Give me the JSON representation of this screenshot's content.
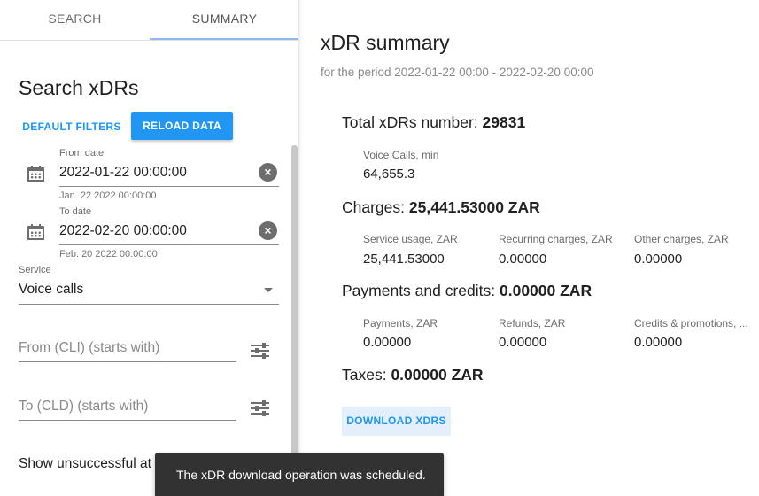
{
  "tabs": [
    {
      "label": "SEARCH"
    },
    {
      "label": "SUMMARY"
    }
  ],
  "search": {
    "title": "Search xDRs",
    "default_filters_label": "DEFAULT FILTERS",
    "reload_label": "RELOAD DATA",
    "from_date": {
      "label": "From date",
      "value": "2022-01-22 00:00:00",
      "hint": "Jan. 22 2022 00:00:00"
    },
    "to_date": {
      "label": "To date",
      "value": "2022-02-20 00:00:00",
      "hint": "Feb. 20 2022 00:00:00"
    },
    "service": {
      "label": "Service",
      "value": "Voice calls"
    },
    "from_cli_placeholder": "From (CLI) (starts with)",
    "to_cld_placeholder": "To (CLD) (starts with)",
    "show_unsuccessful": "Show unsuccessful at"
  },
  "summary": {
    "title": "xDR summary",
    "period": "for the period 2022-01-22 00:00 - 2022-02-20 00:00",
    "total_label": "Total xDRs number: ",
    "total_value": "29831",
    "voice_label": "Voice Calls, min",
    "voice_value": "64,655.3",
    "charges_label": "Charges: ",
    "charges_value": "25,441.53000 ZAR",
    "charges_cells": [
      {
        "label": "Service usage, ZAR",
        "value": "25,441.53000"
      },
      {
        "label": "Recurring charges, ZAR",
        "value": "0.00000"
      },
      {
        "label": "Other charges, ZAR",
        "value": "0.00000"
      }
    ],
    "payments_label": "Payments and credits: ",
    "payments_value": "0.00000 ZAR",
    "payments_cells": [
      {
        "label": "Payments, ZAR",
        "value": "0.00000"
      },
      {
        "label": "Refunds, ZAR",
        "value": "0.00000"
      },
      {
        "label": "Credits & promotions, ...",
        "value": "0.00000"
      }
    ],
    "taxes_label": "Taxes: ",
    "taxes_value": "0.00000 ZAR",
    "download_label": "DOWNLOAD XDRS"
  },
  "toast": {
    "message": "The xDR download operation was scheduled."
  },
  "icons": {
    "calendar": "calendar-icon",
    "clear": "clear-icon",
    "dropdown": "chevron-down-icon",
    "tune": "tune-icon"
  },
  "colors": {
    "accent": "#2196f3",
    "toast_bg": "#323232"
  }
}
